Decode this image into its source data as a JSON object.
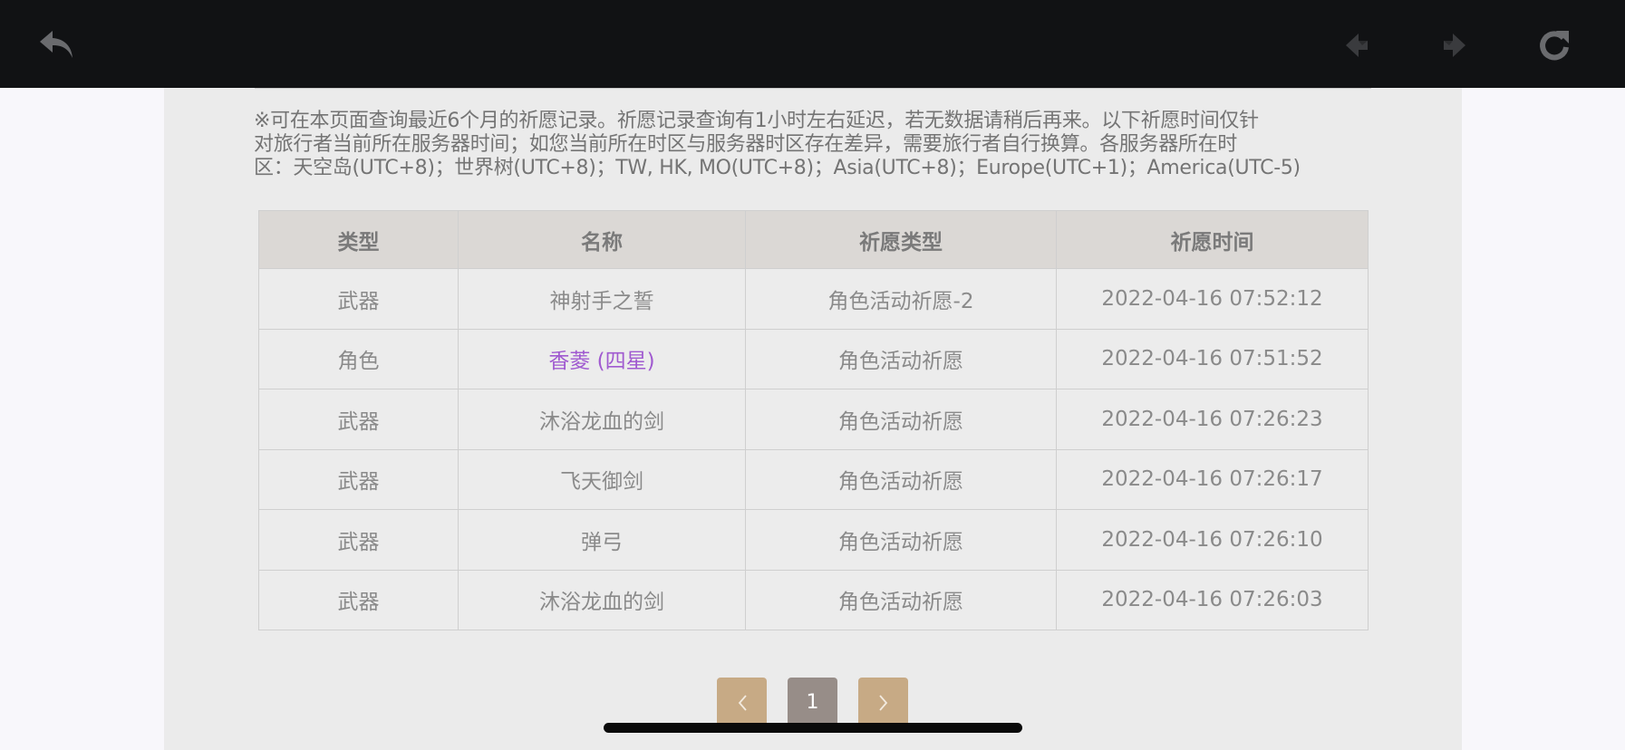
{
  "toolbar": {
    "icons": [
      "back-arrow-icon",
      "prev-page-icon",
      "next-page-icon",
      "refresh-icon"
    ]
  },
  "notice": {
    "lines": [
      "※可在本页面查询最近6个月的祈愿记录。祈愿记录查询有1小时左右延迟，若无数据请稍后再来。以下祈愿时间仅针",
      "对旅行者当前所在服务器时间；如您当前所在时区与服务器时区存在差异，需要旅行者自行换算。各服务器所在时",
      "区：天空岛(UTC+8)；世界树(UTC+8)；TW, HK, MO(UTC+8)；Asia(UTC+8)；Europe(UTC+1)；America(UTC-5)"
    ]
  },
  "table": {
    "headers": [
      "类型",
      "名称",
      "祈愿类型",
      "祈愿时间"
    ],
    "rows": [
      [
        "武器",
        "神射手之誓",
        "角色活动祈愿-2",
        "2022-04-16 07:52:12"
      ],
      [
        "角色",
        "香菱 (四星)",
        "角色活动祈愿",
        "2022-04-16 07:51:52"
      ],
      [
        "武器",
        "沐浴龙血的剑",
        "角色活动祈愿",
        "2022-04-16 07:26:23"
      ],
      [
        "武器",
        "飞天御剑",
        "角色活动祈愿",
        "2022-04-16 07:26:17"
      ],
      [
        "武器",
        "弹弓",
        "角色活动祈愿",
        "2022-04-16 07:26:10"
      ],
      [
        "武器",
        "沐浴龙血的剑",
        "角色活动祈愿",
        "2022-04-16 07:26:03"
      ]
    ],
    "highlight_color": "#a05ad0"
  },
  "pagination": {
    "prev_icon": "chevron-left-icon",
    "current_page": "1",
    "next_icon": "chevron-right-icon"
  },
  "colors": {
    "topbar": "#111214",
    "panel": "#ebebeb",
    "header_bg": "#dbd8d5",
    "pager_nav": "#c7aa85",
    "pager_current": "#978d88"
  }
}
